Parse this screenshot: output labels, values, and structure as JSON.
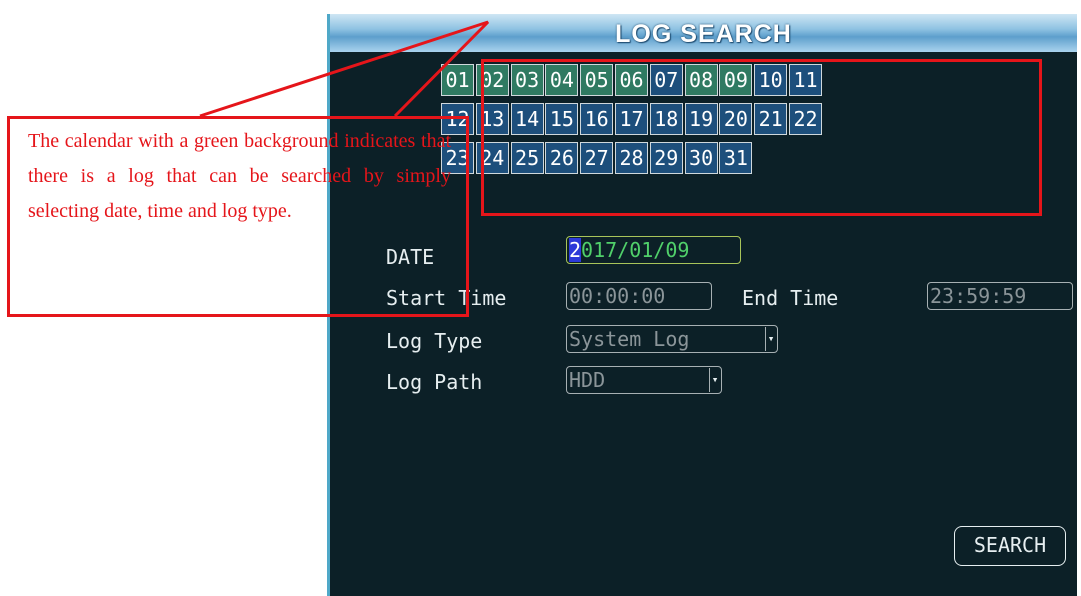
{
  "window": {
    "title": "LOG SEARCH"
  },
  "calendar": {
    "days": [
      {
        "label": "01",
        "has_log": true
      },
      {
        "label": "02",
        "has_log": true
      },
      {
        "label": "03",
        "has_log": true
      },
      {
        "label": "04",
        "has_log": true
      },
      {
        "label": "05",
        "has_log": true
      },
      {
        "label": "06",
        "has_log": true
      },
      {
        "label": "07",
        "has_log": false
      },
      {
        "label": "08",
        "has_log": true
      },
      {
        "label": "09",
        "has_log": true
      },
      {
        "label": "10",
        "has_log": false
      },
      {
        "label": "11",
        "has_log": false
      },
      {
        "label": "12",
        "has_log": false
      },
      {
        "label": "13",
        "has_log": false
      },
      {
        "label": "14",
        "has_log": false
      },
      {
        "label": "15",
        "has_log": false
      },
      {
        "label": "16",
        "has_log": false
      },
      {
        "label": "17",
        "has_log": false
      },
      {
        "label": "18",
        "has_log": false
      },
      {
        "label": "19",
        "has_log": false
      },
      {
        "label": "20",
        "has_log": false
      },
      {
        "label": "21",
        "has_log": false
      },
      {
        "label": "22",
        "has_log": false
      },
      {
        "label": "23",
        "has_log": false
      },
      {
        "label": "24",
        "has_log": false
      },
      {
        "label": "25",
        "has_log": false
      },
      {
        "label": "26",
        "has_log": false
      },
      {
        "label": "27",
        "has_log": false
      },
      {
        "label": "28",
        "has_log": false
      },
      {
        "label": "29",
        "has_log": false
      },
      {
        "label": "30",
        "has_log": false
      },
      {
        "label": "31",
        "has_log": false
      }
    ],
    "colors": {
      "has_log": "#2f7a62",
      "no_log": "#1d4f7c"
    }
  },
  "form": {
    "date": {
      "label": "DATE",
      "cursor_char": "2",
      "rest": "017/01/09"
    },
    "start_time": {
      "label": "Start Time",
      "value": "00:00:00"
    },
    "end_time": {
      "label": "End Time",
      "value": "23:59:59"
    },
    "log_type": {
      "label": "Log Type",
      "value": "System Log"
    },
    "log_path": {
      "label": "Log Path",
      "value": "HDD"
    },
    "search_button": "SEARCH"
  },
  "annotation": {
    "text": "The calendar with a green background indicates that there is a log that can be searched by simply selecting date, time and log type.",
    "color": "#e5151a"
  }
}
